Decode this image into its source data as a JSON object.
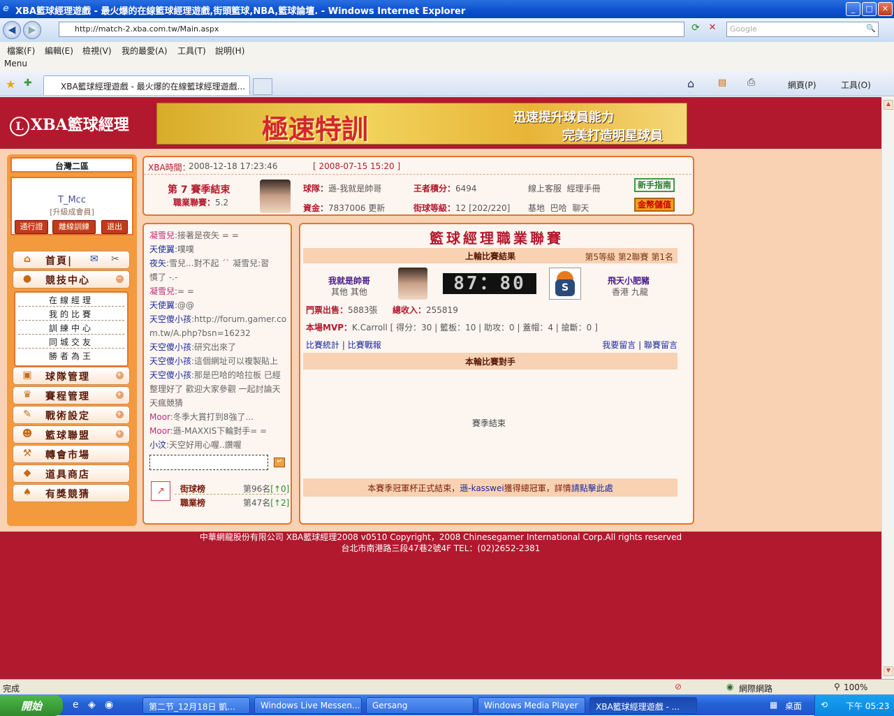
{
  "window": {
    "title": "XBA籃球經理遊戲 - 最火爆的在線籃球經理遊戲,街頭籃球,NBA,籃球論壇. - Windows Internet Explorer",
    "logo": "e",
    "btn_min": "_",
    "btn_max": "□",
    "btn_close": "✕"
  },
  "nav": {
    "back": "◀",
    "forward": "▶",
    "address": "http://match-2.xba.com.tw/Main.aspx",
    "search_placeholder": "Google",
    "refresh": "⟳",
    "stop": "✕",
    "search_go": "🔍"
  },
  "menubar": [
    "檔案(F)",
    "編輯(E)",
    "檢視(V)",
    "我的最愛(A)",
    "工具(T)",
    "說明(H)"
  ],
  "menu_label": "Menu",
  "tabs": {
    "active": "XBA籃球經理遊戲 - 最火爆的在線籃球經理遊戲...",
    "star": "★",
    "add": "✚"
  },
  "commandbar": {
    "home": "⌂",
    "feeds": "▤",
    "print": "⎙",
    "page": "網頁(P)",
    "tools": "工具(O)"
  },
  "site": {
    "brand": "XBA籃球經理",
    "brand_mark": "L",
    "banner_title": "極速特訓",
    "banner_line1": "迅速提升球員能力",
    "banner_line2": "完美打造明星球員"
  },
  "user": {
    "region": "台灣二區",
    "name": "T_Mcc",
    "level": "[升級成會員]",
    "btn_pass": "通行證",
    "btn_offline": "離線訓練",
    "btn_logout": "退出"
  },
  "left_menu": {
    "home": "首頁|",
    "mail_icon": "✉",
    "tools_icon": "✂",
    "compete": "競技中心",
    "compete_toggle": "−",
    "sub": [
      "在線經理",
      "我的比賽",
      "訓練中心",
      "同城交友",
      "勝者為王"
    ],
    "team": "球隊管理",
    "schedule": "賽程管理",
    "tactics": "戰術設定",
    "league": "籃球聯盟",
    "transfer": "轉會市場",
    "shop": "道具商店",
    "lottery": "有獎競猜",
    "plus": "+"
  },
  "topinfo": {
    "time_label": "XBA時間：",
    "time": "2008-12-18 17:23:46",
    "season_date": "[ 2008-07-15 15:20 ]",
    "season": "第 7 賽季結束",
    "league_label": "職業聯賽：",
    "league_val": "5.2",
    "team_label": "球隊：",
    "team_val": "遜-我就是帥哥",
    "funds_label": "資金：",
    "funds_val": "7837006",
    "refresh": "更新",
    "king_label": "王者積分：",
    "king_val": "6494",
    "street_label": "街球等級：",
    "street_val": "12 [202/220]",
    "service": "線上客服",
    "handbook": "經理手冊",
    "base": "基地",
    "bar": "巴哈",
    "chat": "聊天",
    "btn_newbie": "新手指南",
    "btn_gold": "金幣儲值"
  },
  "chat": {
    "lines": [
      {
        "who": "凝雪兒",
        "msg": ":接著是夜矢 = =",
        "who_color": "pink",
        "msg_color": "gray"
      },
      {
        "who": "天使翼",
        "msg": ":噗噗",
        "who_color": "blue",
        "msg_color": "gray"
      },
      {
        "who": "夜矢",
        "msg": ":雪兒...對不起 ˊˋ 凝雪兒:習",
        "who_color": "blue",
        "msg_color": "gray"
      },
      {
        "who": "",
        "msg": "慣了 -.-",
        "who_color": "blue",
        "msg_color": "gray"
      },
      {
        "who": "凝雪兒",
        "msg": ":= =",
        "who_color": "pink",
        "msg_color": "gray"
      },
      {
        "who": "天使翼",
        "msg": ":@@",
        "who_color": "blue",
        "msg_color": "gray"
      },
      {
        "who": "天空傻小孩",
        "msg": ":http://forum.gamer.co",
        "who_color": "blue",
        "msg_color": "gray"
      },
      {
        "who": "",
        "msg": "m.tw/A.php?bsn=16232",
        "who_color": "blue",
        "msg_color": "gray"
      },
      {
        "who": "天空傻小孩",
        "msg": ":研究出來了",
        "who_color": "blue",
        "msg_color": "gray"
      },
      {
        "who": "天空傻小孩",
        "msg": ":這個網址可以複製貼上",
        "who_color": "blue",
        "msg_color": "gray"
      },
      {
        "who": "天空傻小孩",
        "msg": ":那是巴哈的哈拉板 已經",
        "who_color": "blue",
        "msg_color": "gray"
      },
      {
        "who": "",
        "msg": "整理好了 歡迎大家參觀 一起討論天",
        "who_color": "blue",
        "msg_color": "gray"
      },
      {
        "who": "",
        "msg": "天瘋競猜",
        "who_color": "blue",
        "msg_color": "gray"
      },
      {
        "who": "Moor",
        "msg": ":冬季大賞打到8強了...",
        "who_color": "pink",
        "msg_color": "gray"
      },
      {
        "who": "Moor",
        "msg": ":遜-MAXXIS下輪對手= =",
        "who_color": "pink",
        "msg_color": "gray"
      },
      {
        "who": "小汶",
        "msg": ":天空好用心喔..讚喔",
        "who_color": "blue",
        "msg_color": "gray"
      }
    ],
    "send_icon": "↵",
    "rank1_label": "街球榜",
    "rank1_val": "第96名",
    "rank1_delta": "[↑0]",
    "rank2_label": "職業榜",
    "rank2_val": "第47名",
    "rank2_delta": "[↑2]"
  },
  "main": {
    "title": "籃球經理職業聯賽",
    "last_result": "上輪比賽結果",
    "level_info": "第5等級 第2聯賽 第1名",
    "home_team": "我就是帥哥",
    "home_loc": "其他 其他",
    "score": "87：80",
    "away_team": "飛天小肥豬",
    "away_loc": "香港 九龍",
    "ticket_label": "門票出售：",
    "ticket_val": "5883張",
    "income_label": "總收入：",
    "income_val": "255819",
    "mvp_label": "本場MVP：",
    "mvp_val": "K.Carroll [ 得分：30 | 籃板：10 | 助攻：0 | 蓋帽：4 | 搶斷：0 ]",
    "stats_link": "比賽統計",
    "report_link": "比賽戰報",
    "msg_link": "我要留言",
    "league_msg_link": "聯賽留言",
    "sep": "|",
    "opponent_title": "本輪比賽對手",
    "season_end": "賽季結束",
    "notice_a": "本賽季冠軍杯正式結束，",
    "notice_team": "遜-kasswei",
    "notice_b": "獲得總冠軍，詳情",
    "notice_link": "請點擊此處"
  },
  "footer": {
    "line1": "中華網龍股份有限公司 XBA籃球經理2008 v0510  Copyright，2008 Chinesegamer International Corp.All rights reserved",
    "line2": "台北市南港路三段47巷2號4F TEL：(02)2652-2381"
  },
  "statusbar": {
    "left": "完成",
    "zone": "網際網路",
    "zoom": "100%"
  },
  "taskbar": {
    "start": "開始",
    "items": [
      "第二节_12月18日 凱...",
      "Windows Live Messen...",
      "Gersang",
      "Windows Media Player",
      "XBA籃球經理遊戲 - ..."
    ],
    "tray_label": "桌面",
    "clock": "下午 05:23"
  }
}
